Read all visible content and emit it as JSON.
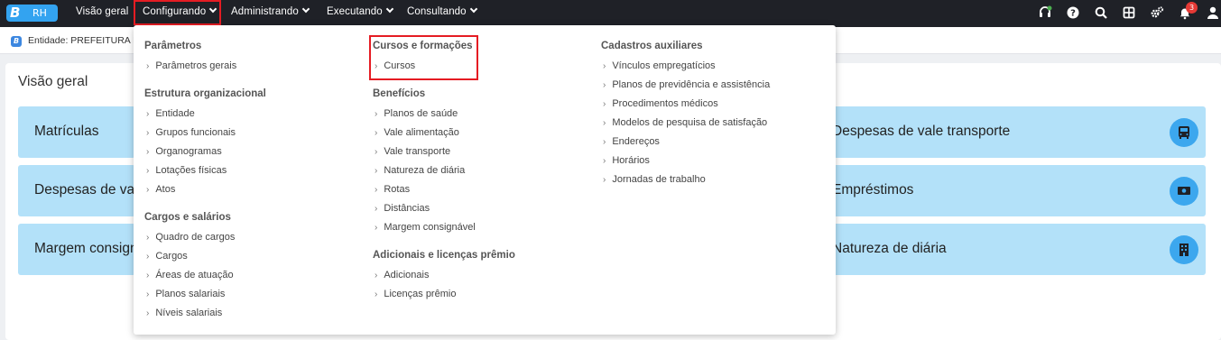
{
  "app": {
    "logo_letter": "B",
    "logo_text": "RH"
  },
  "nav": {
    "items": [
      {
        "label": "Visão geral",
        "has_chevron": false
      },
      {
        "label": "Configurando",
        "has_chevron": true,
        "active": true
      },
      {
        "label": "Administrando",
        "has_chevron": true
      },
      {
        "label": "Executando",
        "has_chevron": true
      },
      {
        "label": "Consultando",
        "has_chevron": true
      }
    ],
    "notification_count": "3",
    "icons": [
      "headset-icon",
      "help-icon",
      "search-icon",
      "apps-grid-icon",
      "settings-icon",
      "bell-icon",
      "user-icon"
    ]
  },
  "breadcrumb": {
    "icon_letter": "B",
    "text": "Entidade: PREFEITURA D"
  },
  "main": {
    "title": "Visão geral",
    "cards_left": [
      "Matrículas",
      "Despesas de val",
      "Margem consign"
    ],
    "cards_right": [
      {
        "label": "Despesas de vale transporte",
        "icon": "bus-icon"
      },
      {
        "label": "Empréstimos",
        "icon": "money-icon"
      },
      {
        "label": "Natureza de diária",
        "icon": "building-icon"
      }
    ]
  },
  "menu": {
    "col1": {
      "sections": [
        {
          "title": "Parâmetros",
          "links": [
            "Parâmetros gerais"
          ]
        },
        {
          "title": "Estrutura organizacional",
          "links": [
            "Entidade",
            "Grupos funcionais",
            "Organogramas",
            "Lotações físicas",
            "Atos"
          ]
        },
        {
          "title": "Cargos e salários",
          "links": [
            "Quadro de cargos",
            "Cargos",
            "Áreas de atuação",
            "Planos salariais",
            "Níveis salariais"
          ]
        }
      ]
    },
    "col2": {
      "sections": [
        {
          "title": "Cursos e formações",
          "links": [
            "Cursos"
          ]
        },
        {
          "title": "Benefícios",
          "links": [
            "Planos de saúde",
            "Vale alimentação",
            "Vale transporte",
            "Natureza de diária",
            "Rotas",
            "Distâncias",
            "Margem consignável"
          ]
        },
        {
          "title": "Adicionais e licenças prêmio",
          "links": [
            "Adicionais",
            "Licenças prêmio"
          ]
        }
      ]
    },
    "col3": {
      "sections": [
        {
          "title": "Cadastros auxiliares",
          "links": [
            "Vínculos empregatícios",
            "Planos de previdência e assistência",
            "Procedimentos médicos",
            "Modelos de pesquisa de satisfação",
            "Endereços",
            "Horários",
            "Jornadas de trabalho"
          ]
        }
      ]
    },
    "link_prefix": "›"
  },
  "colors": {
    "topbar": "#1f2127",
    "accent": "#33a3f0",
    "card": "#b3e1f9",
    "card_icon": "#3ca7ee",
    "highlight": "#e51c23",
    "badge": "#e53935",
    "online_dot": "#4caf50"
  }
}
